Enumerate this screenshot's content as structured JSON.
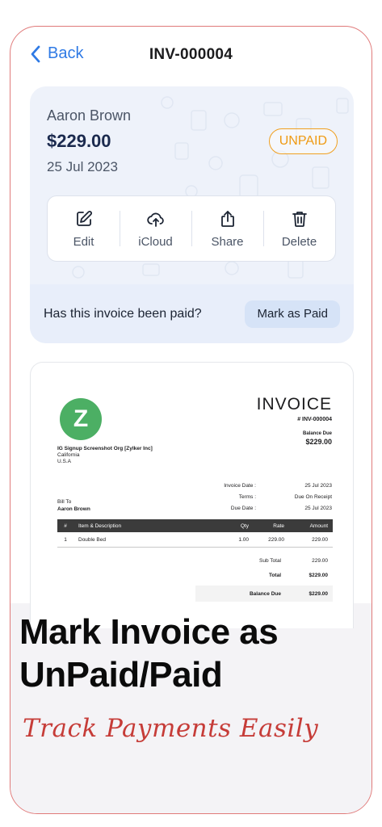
{
  "nav": {
    "back_label": "Back",
    "title": "INV-000004"
  },
  "summary": {
    "client_name": "Aaron Brown",
    "amount": "$229.00",
    "date": "25 Jul 2023",
    "status": "UNPAID",
    "actions": [
      {
        "label": "Edit",
        "icon": "edit-icon"
      },
      {
        "label": "iCloud",
        "icon": "cloud-upload-icon"
      },
      {
        "label": "Share",
        "icon": "share-icon"
      },
      {
        "label": "Delete",
        "icon": "trash-icon"
      }
    ],
    "paid_question": "Has this invoice been paid?",
    "mark_paid_label": "Mark as Paid"
  },
  "invoice": {
    "logo_letter": "Z",
    "heading": "INVOICE",
    "number": "# INV-000004",
    "balance_due_label": "Balance Due",
    "balance_due_value": "$229.00",
    "org_name": "IG Signup Screenshot Org [Zylker Inc]",
    "org_state": "California",
    "org_country": "U.S.A",
    "meta": [
      {
        "label": "Invoice Date :",
        "value": "25 Jul 2023"
      },
      {
        "label": "Terms :",
        "value": "Due On Receipt"
      },
      {
        "label": "Due Date :",
        "value": "25 Jul 2023"
      }
    ],
    "bill_to_label": "Bill To",
    "bill_to_name": "Aaron Brown",
    "table_headers": {
      "num": "#",
      "desc": "Item & Description",
      "qty": "Qty",
      "rate": "Rate",
      "amount": "Amount"
    },
    "rows": [
      {
        "num": "1",
        "desc": "Double Bed",
        "qty": "1.00",
        "rate": "229.00",
        "amount": "229.00"
      }
    ],
    "sub_total_label": "Sub Total",
    "sub_total_value": "229.00",
    "total_label": "Total",
    "total_value": "$229.00",
    "balance_label": "Balance Due",
    "balance_value": "$229.00"
  },
  "marketing": {
    "headline_line1": "Mark Invoice as",
    "headline_line2": "UnPaid/Paid",
    "tagline": "Track Payments Easily"
  },
  "colors": {
    "accent": "#2f7ae5",
    "status_unpaid": "#ef9a12",
    "tagline": "#c63c38",
    "logo": "#4caf64"
  }
}
